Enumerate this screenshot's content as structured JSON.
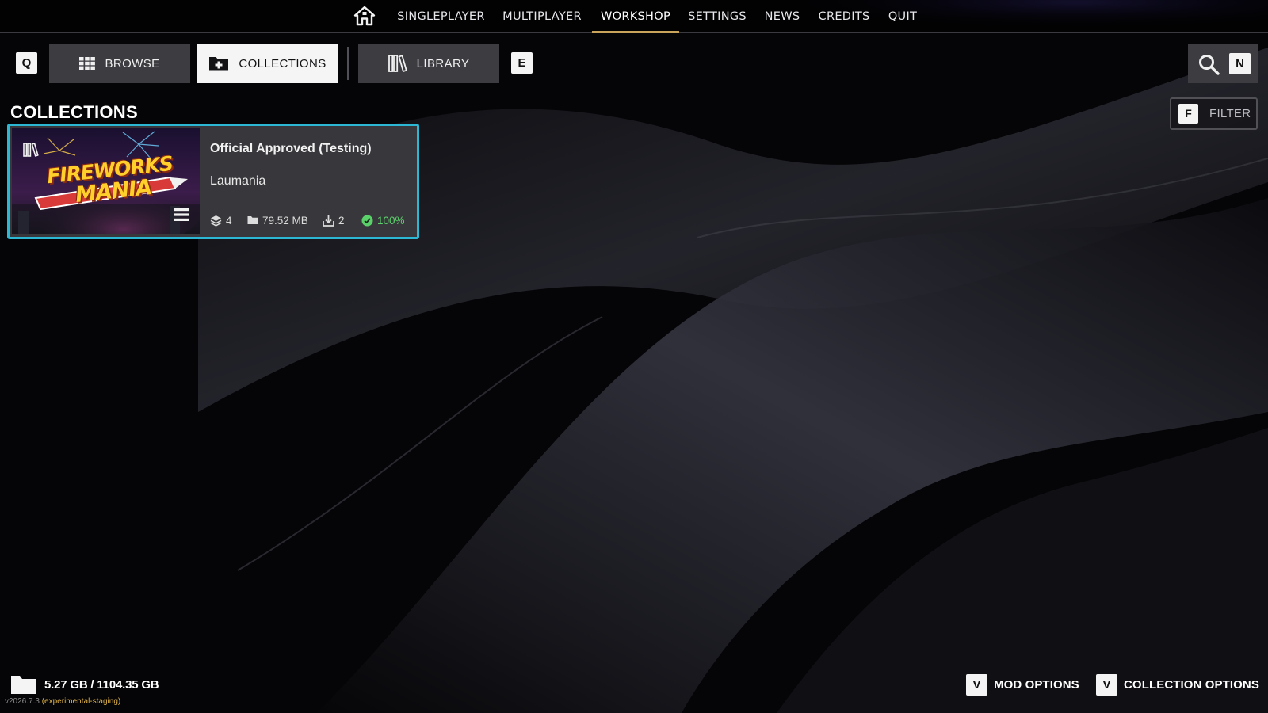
{
  "nav": {
    "items": [
      {
        "label": "SINGLEPLAYER",
        "active": false
      },
      {
        "label": "MULTIPLAYER",
        "active": false
      },
      {
        "label": "WORKSHOP",
        "active": true
      },
      {
        "label": "SETTINGS",
        "active": false
      },
      {
        "label": "NEWS",
        "active": false
      },
      {
        "label": "CREDITS",
        "active": false
      },
      {
        "label": "QUIT",
        "active": false
      }
    ]
  },
  "toolbar": {
    "prev_key": "Q",
    "next_key": "E",
    "browse_label": "BROWSE",
    "collections_label": "COLLECTIONS",
    "library_label": "LIBRARY",
    "search_key": "N",
    "filter_key": "F",
    "filter_label": "FILTER"
  },
  "page": {
    "title": "COLLECTIONS"
  },
  "collections": [
    {
      "title": "Official Approved (Testing)",
      "author": "Laumania",
      "thumbnail_text": [
        "FIREWORKS",
        "MANIA"
      ],
      "mods": "4",
      "size": "79.52 MB",
      "downloads": "2",
      "complete": "100%"
    }
  ],
  "footer": {
    "storage": "5.27 GB / 1104.35 GB",
    "version": "v2026.7.3",
    "branch": "(experimental-staging)",
    "mod_options_key": "V",
    "mod_options_label": "MOD OPTIONS",
    "collection_options_key": "V",
    "collection_options_label": "COLLECTION OPTIONS"
  },
  "colors": {
    "accent": "#c9a45a",
    "card_border": "#2cb7d4",
    "success": "#5bd16a",
    "branch": "#e0b34a"
  },
  "icons": {
    "home": "home-icon",
    "browse": "grid-icon",
    "collections": "folder-plus-icon",
    "library": "books-icon",
    "search": "search-icon",
    "menu": "hamburger-icon",
    "mods": "layers-icon",
    "size": "folder-icon",
    "downloads": "download-icon",
    "complete": "check-circle-icon"
  }
}
